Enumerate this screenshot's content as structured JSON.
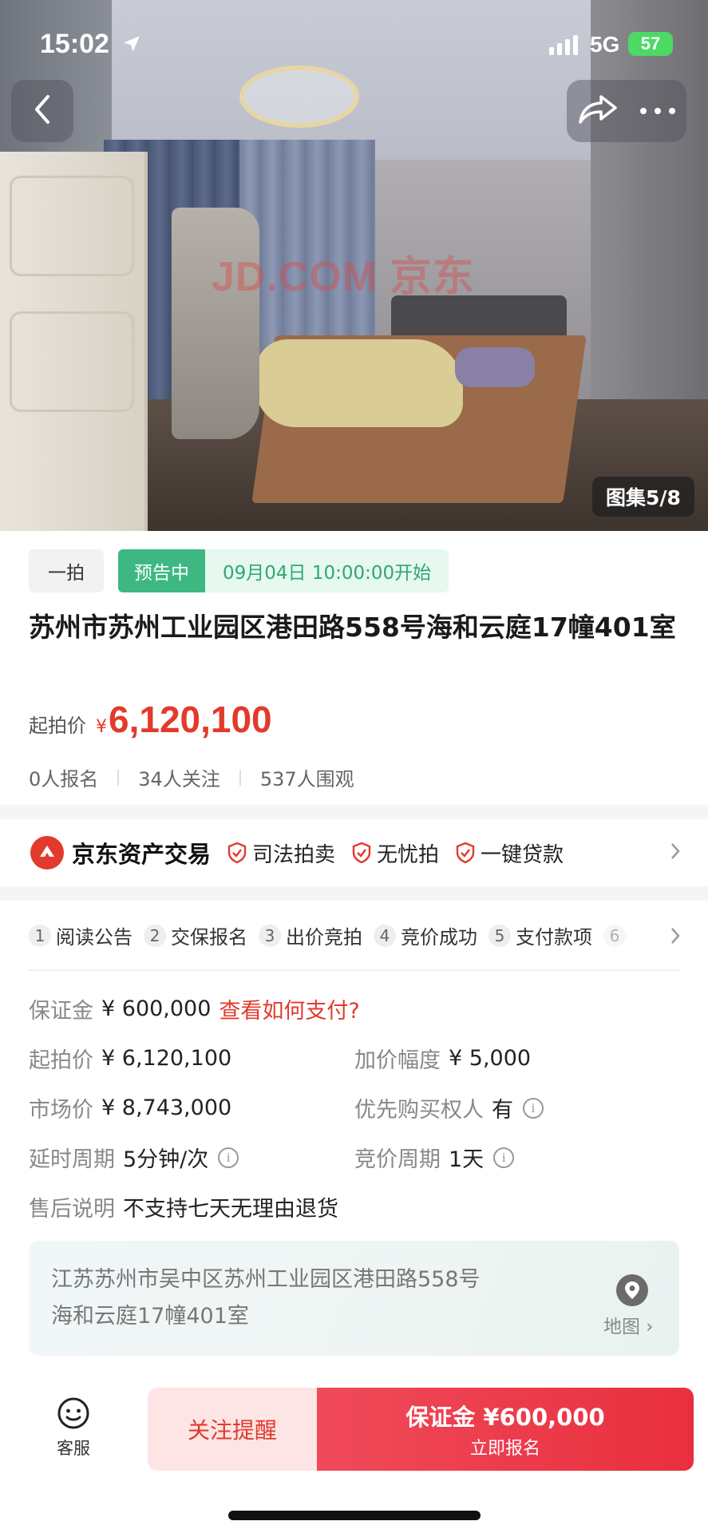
{
  "status_bar": {
    "time": "15:02",
    "network": "5G",
    "battery": "57"
  },
  "hero": {
    "watermark": "JD.COM 京东",
    "gallery": "图集5/8"
  },
  "tags": {
    "type": "一拍",
    "status": "预告中",
    "start_time": "09月04日 10:00:00开始"
  },
  "title": "苏州市苏州工业园区港田路558号海和云庭17幢401室",
  "price": {
    "label": "起拍价",
    "currency": "¥",
    "value": "6,120,100"
  },
  "stats": [
    "0人报名",
    "34人关注",
    "537人围观"
  ],
  "platform": {
    "name": "京东资产交易",
    "features": [
      "司法拍卖",
      "无忧拍",
      "一键贷款"
    ]
  },
  "steps": [
    {
      "num": "1",
      "label": "阅读公告"
    },
    {
      "num": "2",
      "label": "交保报名"
    },
    {
      "num": "3",
      "label": "出价竞拍"
    },
    {
      "num": "4",
      "label": "竞价成功"
    },
    {
      "num": "5",
      "label": "支付款项"
    },
    {
      "num": "6",
      "label": ""
    }
  ],
  "details": {
    "deposit_label": "保证金",
    "deposit_value": "¥ 600,000",
    "deposit_link": "查看如何支付?",
    "start_label": "起拍价",
    "start_value": "¥ 6,120,100",
    "increment_label": "加价幅度",
    "increment_value": "¥ 5,000",
    "market_label": "市场价",
    "market_value": "¥ 8,743,000",
    "priority_label": "优先购买权人",
    "priority_value": "有",
    "delay_label": "延时周期",
    "delay_value": "5分钟/次",
    "cycle_label": "竞价周期",
    "cycle_value": "1天",
    "aftersale_label": "售后说明",
    "aftersale_value": "不支持七天无理由退货"
  },
  "address": {
    "line1": "江苏苏州市吴中区苏州工业园区港田路558号",
    "line2": "海和云庭17幢401室",
    "map_label": "地图"
  },
  "bottom": {
    "service_label": "客服",
    "follow_label": "关注提醒",
    "signup_main": "保证金 ¥600,000",
    "signup_sub": "立即报名"
  },
  "colors": {
    "accent": "#e23a2c",
    "status_green": "#3db883"
  },
  "icons": [
    "location-arrow-icon",
    "signal-icon",
    "battery-icon",
    "back-icon",
    "share-icon",
    "more-icon",
    "shield-check-icon",
    "chevron-right-icon",
    "info-icon",
    "map-pin-icon",
    "customer-service-icon"
  ]
}
